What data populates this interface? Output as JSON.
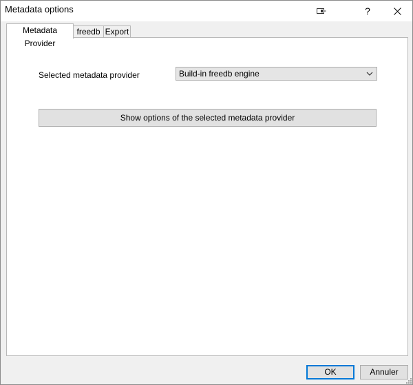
{
  "window": {
    "title": "Metadata options"
  },
  "titlebar": {
    "pin_icon": "pin-window-icon",
    "help_label": "?",
    "close_icon": "close-icon"
  },
  "tabs": [
    {
      "label": "Metadata Provider",
      "active": true
    },
    {
      "label": "freedb",
      "active": false
    },
    {
      "label": "Export",
      "active": false
    }
  ],
  "provider": {
    "label": "Selected metadata provider",
    "selected": "Build-in freedb engine",
    "chevron_icon": "chevron-down-icon"
  },
  "options_button": {
    "label": "Show options of the selected metadata provider"
  },
  "footer": {
    "ok_label": "OK",
    "cancel_label": "Annuler"
  },
  "colors": {
    "accent": "#0078d7",
    "panel_bg": "#ffffff",
    "dialog_bg": "#f0f0f0",
    "button_bg": "#e1e1e1"
  }
}
